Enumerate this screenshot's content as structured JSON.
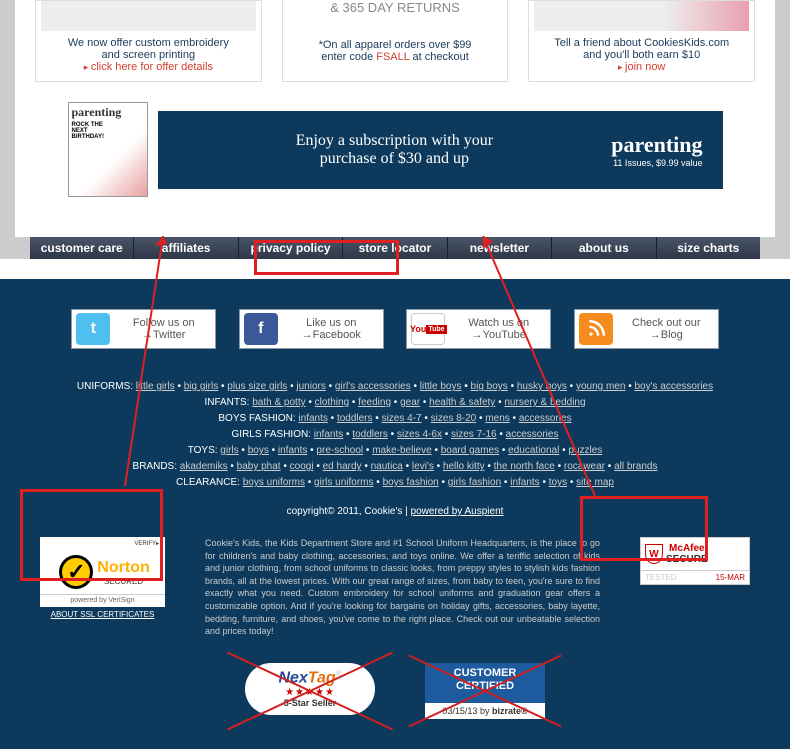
{
  "promos": [
    {
      "line1": "We now offer custom embroidery",
      "line2": "and screen printing",
      "link": "click here for offer details"
    },
    {
      "title": "& 365 DAY RETURNS",
      "line1": "*On all apparel orders over $99",
      "line2_a": "enter code ",
      "code": "FSALL",
      "line2_b": " at checkout"
    },
    {
      "line1": "Tell a friend about CookiesKids.com",
      "line2": "and you'll both earn $10",
      "link": "join now"
    }
  ],
  "banner": {
    "mag_title": "parenting",
    "mag_sub1": "ROCK THE",
    "mag_sub2": "NEXT",
    "mag_sub3": "BIRTHDAY!",
    "text1": "Enjoy a subscription with your",
    "text2": "purchase of $30 and up",
    "brand": "parenting",
    "tag": "11 Issues, $9.99 value"
  },
  "nav": [
    "customer care",
    "affiliates",
    "privacy policy",
    "store locator",
    "newsletter",
    "about us",
    "size charts"
  ],
  "social": [
    {
      "line1": "Follow us on",
      "line2": "→Twitter"
    },
    {
      "line1": "Like us on",
      "line2": "→Facebook"
    },
    {
      "line1": "Watch us on",
      "line2": "→YouTube"
    },
    {
      "line1": "Check out our",
      "line2": "→Blog"
    }
  ],
  "categories": {
    "rows": [
      {
        "label": "UNIFORMS:",
        "items": [
          "little girls",
          "big girls",
          "plus size girls",
          "juniors",
          "girl's accessories",
          "little boys",
          "big boys",
          "husky boys",
          "young men",
          "boy's accessories"
        ]
      },
      {
        "label": "INFANTS:",
        "items": [
          "bath & potty",
          "clothing",
          "feeding",
          "gear",
          "health & safety",
          "nursery & bedding"
        ]
      },
      {
        "label": "BOYS FASHION:",
        "items": [
          "infants",
          "toddlers",
          "sizes 4-7",
          "sizes 8-20",
          "mens",
          "accessories"
        ]
      },
      {
        "label": "GIRLS FASHION:",
        "items": [
          "infants",
          "toddlers",
          "sizes 4-6x",
          "sizes 7-16",
          "accessories"
        ]
      },
      {
        "label": "TOYS:",
        "items": [
          "girls",
          "boys",
          "infants",
          "pre-school",
          "make-believe",
          "board games",
          "educational",
          "puzzles"
        ]
      },
      {
        "label": "BRANDS:",
        "items": [
          "akademiks",
          "baby phat",
          "coogi",
          "ed hardy",
          "nautica",
          "levi's",
          "hello kitty",
          "the north face",
          "rocawear",
          "all brands"
        ]
      },
      {
        "label": "CLEARANCE:",
        "items": [
          "boys uniforms",
          "girls uniforms",
          "boys fashion",
          "girls fashion",
          "infants",
          "toys",
          "site map"
        ]
      }
    ]
  },
  "copyright": {
    "text": "copyright© 2011, Cookie's  |  ",
    "link": "powered by Auspient"
  },
  "ssl_label": "ABOUT SSL CERTIFICATES",
  "norton": {
    "verify": "VERIFY▸",
    "brand": "Norton",
    "secured": "SECURED",
    "powered": "powered by VeriSign"
  },
  "description": "Cookie's Kids, the Kids Department Store and #1 School Uniform Headquarters, is the place to go for children's and baby clothing, accessories, and toys online. We offer a teriffic selection of kids and junior clothing, from school uniforms to classic looks, from preppy styles to stylish kids fashion brands, all at the lowest prices. With our great range of sizes, from baby to teen, you're sure to find exactly what you need. Custom embroidery for school uniforms and graduation gear offers a customizable option. And if you're looking for bargains on holiday gifts, accessories, baby layette, bedding, furniture, and shoes, you've come to the right place. Check out our unbeatable selection and prices today!",
  "mcafee": {
    "brand1": "McAfee",
    "brand2": "SECURE",
    "tested": "TESTED",
    "date": "15-MAR"
  },
  "nextag": {
    "nex": "Nex",
    "tag": "Tag",
    "stars": "★★★★★",
    "sub": "5-Star Seller"
  },
  "bizrate": {
    "line1": "CUSTOMER",
    "line2": "CERTIFIED",
    "date": "03/15/13",
    "by": " by ",
    "brand": "bizrate®"
  }
}
